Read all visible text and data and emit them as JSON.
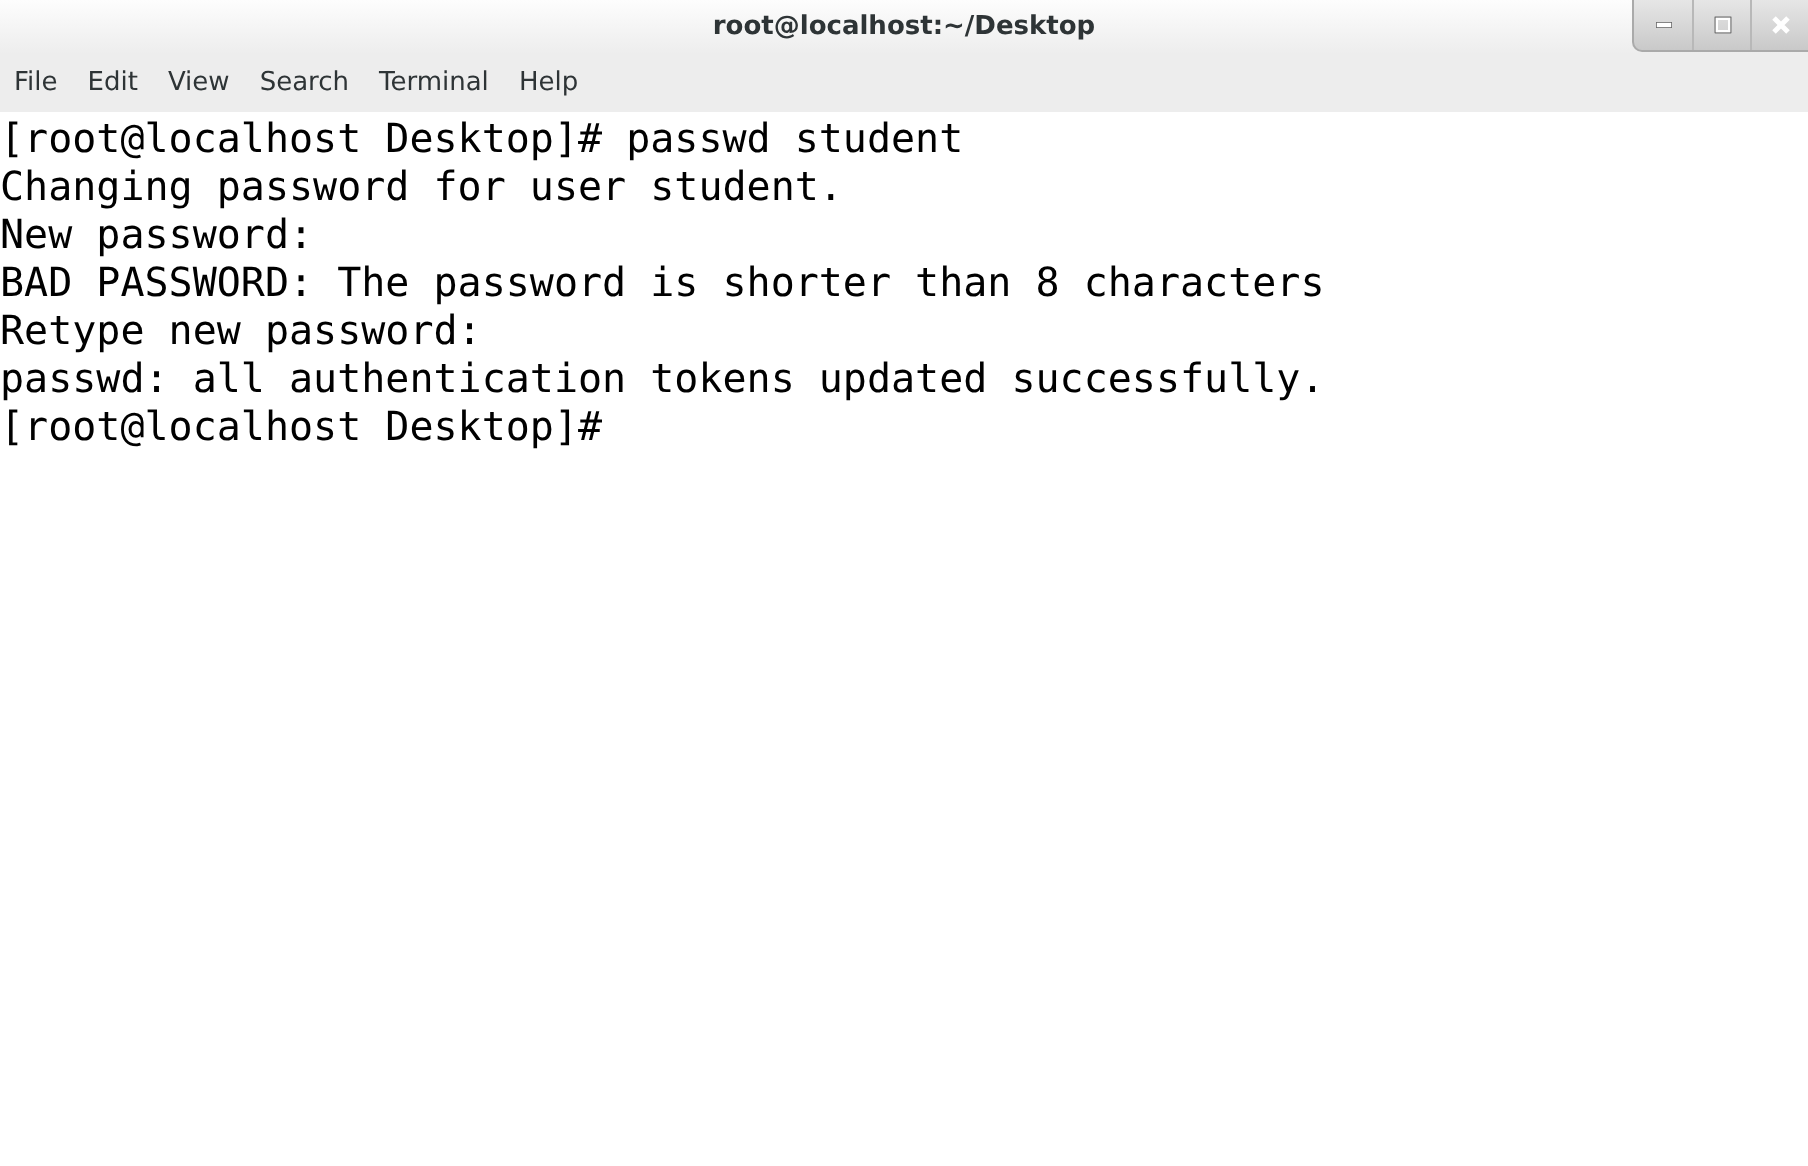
{
  "window": {
    "title": "root@localhost:~/Desktop"
  },
  "menu": [
    "File",
    "Edit",
    "View",
    "Search",
    "Terminal",
    "Help"
  ],
  "terminal": {
    "lines": [
      "[root@localhost Desktop]# passwd student",
      "Changing password for user student.",
      "New password:",
      "BAD PASSWORD: The password is shorter than 8 characters",
      "Retype new password:",
      "passwd: all authentication tokens updated successfully.",
      "[root@localhost Desktop]#"
    ]
  }
}
